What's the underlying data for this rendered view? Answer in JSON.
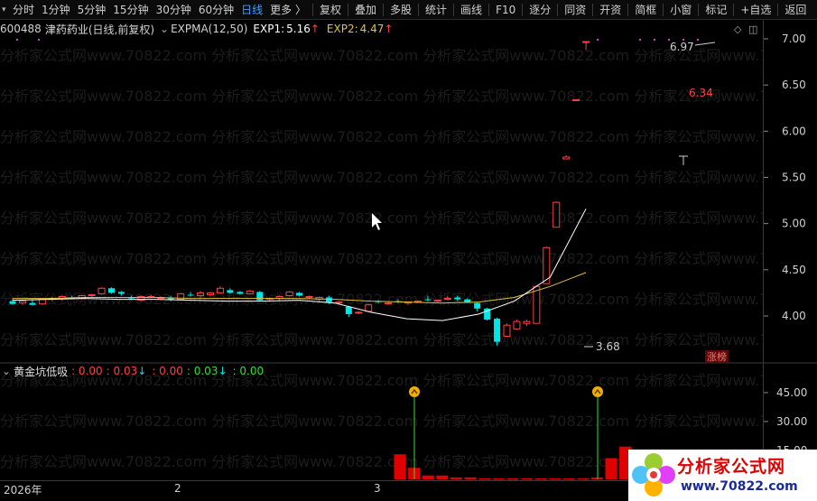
{
  "toolbar": {
    "items": [
      "分时",
      "1分钟",
      "5分钟",
      "15分钟",
      "30分钟",
      "60分钟",
      "日线",
      "更多 〉",
      "复权",
      "叠加",
      "多股",
      "统计",
      "画线",
      "F10",
      "逐分",
      "同资",
      "开资",
      "简框",
      "小窗",
      "标记",
      "+自选",
      "返回"
    ],
    "active": "日线"
  },
  "stock": {
    "code": "600488",
    "name": "津药药业",
    "period_label": "(日线,前复权)",
    "indicator": "EXPMA(12,50)",
    "exp1_label": "EXP1:",
    "exp1_value": "5.16",
    "exp2_label": "EXP2:",
    "exp2_value": "4.47"
  },
  "indicator_panel": {
    "name": "黄金坑低吸",
    "v1": ": 0.00",
    "v2": ": 0.03",
    "v3": ": 0.00",
    "v4": ": 0.03",
    "v5": ": 0.00"
  },
  "price_annotations": {
    "high": "6.97",
    "mid": "6.34",
    "low": "3.68",
    "badge": "涨榜"
  },
  "yaxis_main": [
    "7.00",
    "6.50",
    "6.00",
    "5.50",
    "5.00",
    "4.50",
    "4.00"
  ],
  "yaxis_sub": [
    "45.00",
    "30.00",
    "15.00"
  ],
  "dates": [
    "2026年",
    "2",
    "3"
  ],
  "watermark": "分析家公式网www.70822.com",
  "logo": {
    "main": "分析家公式网",
    "url": "www.70822.com"
  },
  "colors": {
    "up": "#ff4040",
    "down": "#00e5e5",
    "exp1": "#ffffff",
    "exp2": "#e0c040",
    "active": "#3da2ff",
    "green": "#2fe02f",
    "red_bar": "#e00000"
  },
  "chart_data": {
    "type": "candlestick",
    "ylim": [
      3.5,
      7.1
    ],
    "candles": [
      {
        "o": 4.16,
        "h": 4.19,
        "l": 4.12,
        "c": 4.13
      },
      {
        "o": 4.14,
        "h": 4.18,
        "l": 4.12,
        "c": 4.16
      },
      {
        "o": 4.14,
        "h": 4.18,
        "l": 4.11,
        "c": 4.12
      },
      {
        "o": 4.13,
        "h": 4.19,
        "l": 4.12,
        "c": 4.18
      },
      {
        "o": 4.18,
        "h": 4.21,
        "l": 4.16,
        "c": 4.19
      },
      {
        "o": 4.19,
        "h": 4.22,
        "l": 4.17,
        "c": 4.21
      },
      {
        "o": 4.2,
        "h": 4.22,
        "l": 4.18,
        "c": 4.19
      },
      {
        "o": 4.19,
        "h": 4.23,
        "l": 4.18,
        "c": 4.22
      },
      {
        "o": 4.22,
        "h": 4.24,
        "l": 4.21,
        "c": 4.23
      },
      {
        "o": 4.24,
        "h": 4.31,
        "l": 4.23,
        "c": 4.3
      },
      {
        "o": 4.3,
        "h": 4.31,
        "l": 4.24,
        "c": 4.25
      },
      {
        "o": 4.26,
        "h": 4.27,
        "l": 4.22,
        "c": 4.24
      },
      {
        "o": 4.2,
        "h": 4.22,
        "l": 4.17,
        "c": 4.19
      },
      {
        "o": 4.17,
        "h": 4.22,
        "l": 4.16,
        "c": 4.21
      },
      {
        "o": 4.21,
        "h": 4.23,
        "l": 4.2,
        "c": 4.21
      },
      {
        "o": 4.19,
        "h": 4.21,
        "l": 4.17,
        "c": 4.2
      },
      {
        "o": 4.19,
        "h": 4.22,
        "l": 4.16,
        "c": 4.18
      },
      {
        "o": 4.18,
        "h": 4.25,
        "l": 4.17,
        "c": 4.24
      },
      {
        "o": 4.23,
        "h": 4.26,
        "l": 4.21,
        "c": 4.22
      },
      {
        "o": 4.22,
        "h": 4.27,
        "l": 4.2,
        "c": 4.25
      },
      {
        "o": 4.23,
        "h": 4.26,
        "l": 4.21,
        "c": 4.25
      },
      {
        "o": 4.25,
        "h": 4.32,
        "l": 4.24,
        "c": 4.3
      },
      {
        "o": 4.28,
        "h": 4.3,
        "l": 4.24,
        "c": 4.25
      },
      {
        "o": 4.26,
        "h": 4.27,
        "l": 4.23,
        "c": 4.24
      },
      {
        "o": 4.24,
        "h": 4.28,
        "l": 4.23,
        "c": 4.27
      },
      {
        "o": 4.26,
        "h": 4.27,
        "l": 4.16,
        "c": 4.17
      },
      {
        "o": 4.18,
        "h": 4.2,
        "l": 4.16,
        "c": 4.19
      },
      {
        "o": 4.19,
        "h": 4.22,
        "l": 4.17,
        "c": 4.21
      },
      {
        "o": 4.22,
        "h": 4.27,
        "l": 4.21,
        "c": 4.26
      },
      {
        "o": 4.25,
        "h": 4.26,
        "l": 4.21,
        "c": 4.22
      },
      {
        "o": 4.2,
        "h": 4.22,
        "l": 4.18,
        "c": 4.21
      },
      {
        "o": 4.18,
        "h": 4.21,
        "l": 4.16,
        "c": 4.2
      },
      {
        "o": 4.2,
        "h": 4.22,
        "l": 4.13,
        "c": 4.15
      },
      {
        "o": 4.14,
        "h": 4.16,
        "l": 4.12,
        "c": 4.15
      },
      {
        "o": 4.1,
        "h": 4.11,
        "l": 3.99,
        "c": 4.02
      },
      {
        "o": 4.03,
        "h": 4.05,
        "l": 4.02,
        "c": 4.04
      },
      {
        "o": 4.05,
        "h": 4.13,
        "l": 4.04,
        "c": 4.12
      },
      {
        "o": 4.16,
        "h": 4.17,
        "l": 4.14,
        "c": 4.15
      },
      {
        "o": 4.14,
        "h": 4.15,
        "l": 4.12,
        "c": 4.14
      },
      {
        "o": 4.16,
        "h": 4.18,
        "l": 4.14,
        "c": 4.15
      },
      {
        "o": 4.14,
        "h": 4.16,
        "l": 4.12,
        "c": 4.15
      },
      {
        "o": 4.15,
        "h": 4.17,
        "l": 4.14,
        "c": 4.16
      },
      {
        "o": 4.18,
        "h": 4.22,
        "l": 4.16,
        "c": 4.17
      },
      {
        "o": 4.16,
        "h": 4.18,
        "l": 4.15,
        "c": 4.17
      },
      {
        "o": 4.18,
        "h": 4.22,
        "l": 4.17,
        "c": 4.19
      },
      {
        "o": 4.2,
        "h": 4.22,
        "l": 4.16,
        "c": 4.18
      },
      {
        "o": 4.18,
        "h": 4.19,
        "l": 4.14,
        "c": 4.15
      },
      {
        "o": 4.14,
        "h": 4.15,
        "l": 4.05,
        "c": 4.08
      },
      {
        "o": 4.08,
        "h": 4.09,
        "l": 3.95,
        "c": 3.96
      },
      {
        "o": 3.97,
        "h": 3.98,
        "l": 3.68,
        "c": 3.72
      },
      {
        "o": 3.78,
        "h": 3.92,
        "l": 3.77,
        "c": 3.9
      },
      {
        "o": 3.86,
        "h": 3.96,
        "l": 3.85,
        "c": 3.94
      },
      {
        "o": 3.92,
        "h": 3.96,
        "l": 3.89,
        "c": 3.94
      },
      {
        "o": 3.92,
        "h": 4.33,
        "l": 3.92,
        "c": 4.32
      },
      {
        "o": 4.35,
        "h": 4.75,
        "l": 4.35,
        "c": 4.74
      },
      {
        "o": 4.96,
        "h": 5.24,
        "l": 4.96,
        "c": 5.23
      },
      {
        "o": 5.7,
        "h": 5.74,
        "l": 5.7,
        "c": 5.72
      },
      {
        "o": 6.34,
        "h": 6.34,
        "l": 6.34,
        "c": 6.34
      },
      {
        "o": 6.97,
        "h": 6.97,
        "l": 6.88,
        "c": 6.97
      }
    ],
    "exp1_values": [
      4.17,
      4.18,
      4.19,
      4.18,
      4.18,
      4.17,
      4.16,
      4.16,
      4.17,
      4.14,
      4.04,
      3.97,
      3.95,
      4.02,
      4.16,
      4.42,
      5.16
    ],
    "exp2_values": [
      4.19,
      4.19,
      4.2,
      4.2,
      4.2,
      4.19,
      4.19,
      4.19,
      4.19,
      4.18,
      4.16,
      4.15,
      4.14,
      4.15,
      4.2,
      4.32,
      4.47
    ],
    "sub_ylim": [
      0,
      52
    ],
    "sub_bars": [
      13,
      6,
      2,
      2,
      1,
      1,
      0.5,
      0.5,
      0.5,
      0.5,
      0.5,
      0.5,
      0.5,
      0.5,
      1,
      11,
      17,
      9,
      5,
      1
    ],
    "sub_markers": [
      {
        "value": 45
      },
      {
        "value": 45
      }
    ]
  }
}
